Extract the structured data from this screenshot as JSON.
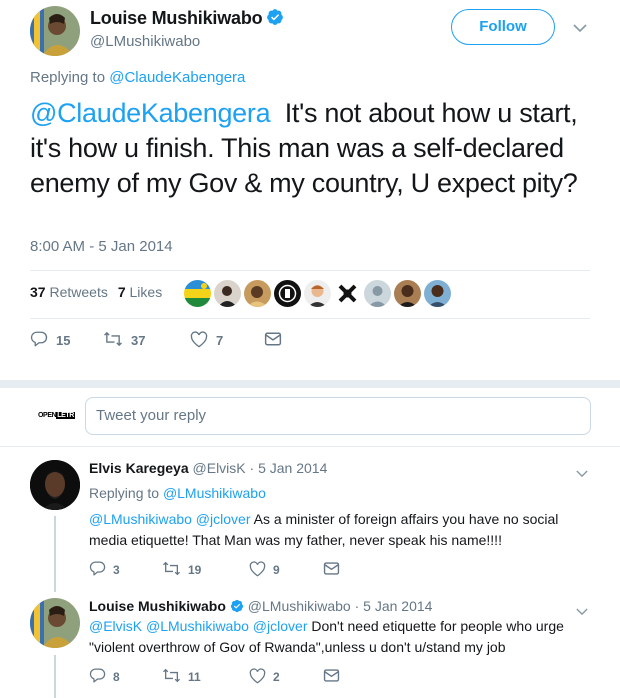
{
  "main_tweet": {
    "author_name": "Louise Mushikiwabo",
    "author_handle": "@LMushikiwabo",
    "follow_label": "Follow",
    "replying_label": "Replying to",
    "replying_to": "@ClaudeKabengera",
    "mention": "@ClaudeKabengera",
    "text": "  It's not about how u start, it's how u finish. This man was a self-declared enemy of my Gov & my country, U expect pity?",
    "timestamp": "8:00 AM - 5 Jan 2014",
    "retweets_count": "37",
    "retweets_label": "Retweets",
    "likes_count": "7",
    "likes_label": "Likes",
    "reply_count": "15",
    "retweet_count_action": "37",
    "like_count_action": "7"
  },
  "reply_box": {
    "avatar_text_left": "OPEN",
    "avatar_text_box": "LETR",
    "placeholder": "Tweet your reply"
  },
  "replies": [
    {
      "author_name": "Elvis Karegeya",
      "author_handle": "@ElvisK",
      "date": "· 5 Jan 2014",
      "replying_label": "Replying to",
      "replying_to": "@LMushikiwabo",
      "mentions": "@LMushikiwabo @jclover",
      "text": " As a minister of foreign affairs you have no social media etiquette! That Man was my father, never speak his name!!!!",
      "reply_count": "3",
      "retweet_count": "19",
      "like_count": "9"
    },
    {
      "author_name": "Louise Mushikiwabo",
      "author_handle": "@LMushikiwabo",
      "date": "· 5 Jan 2014",
      "mentions": "@ElvisK @LMushikiwabo @jclover",
      "text": " Don't need etiquette for people who urge \"violent overthrow of Gov of Rwanda\",unless u don't u/stand my job",
      "reply_count": "8",
      "retweet_count": "11",
      "like_count": "2"
    }
  ],
  "colors": {
    "accent": "#1da1f2",
    "secondary_text": "#657786",
    "divider": "#e6ecf0"
  },
  "icons": [
    "verified-badge-icon",
    "chevron-down-icon",
    "reply-icon",
    "retweet-icon",
    "heart-icon",
    "direct-message-icon"
  ]
}
